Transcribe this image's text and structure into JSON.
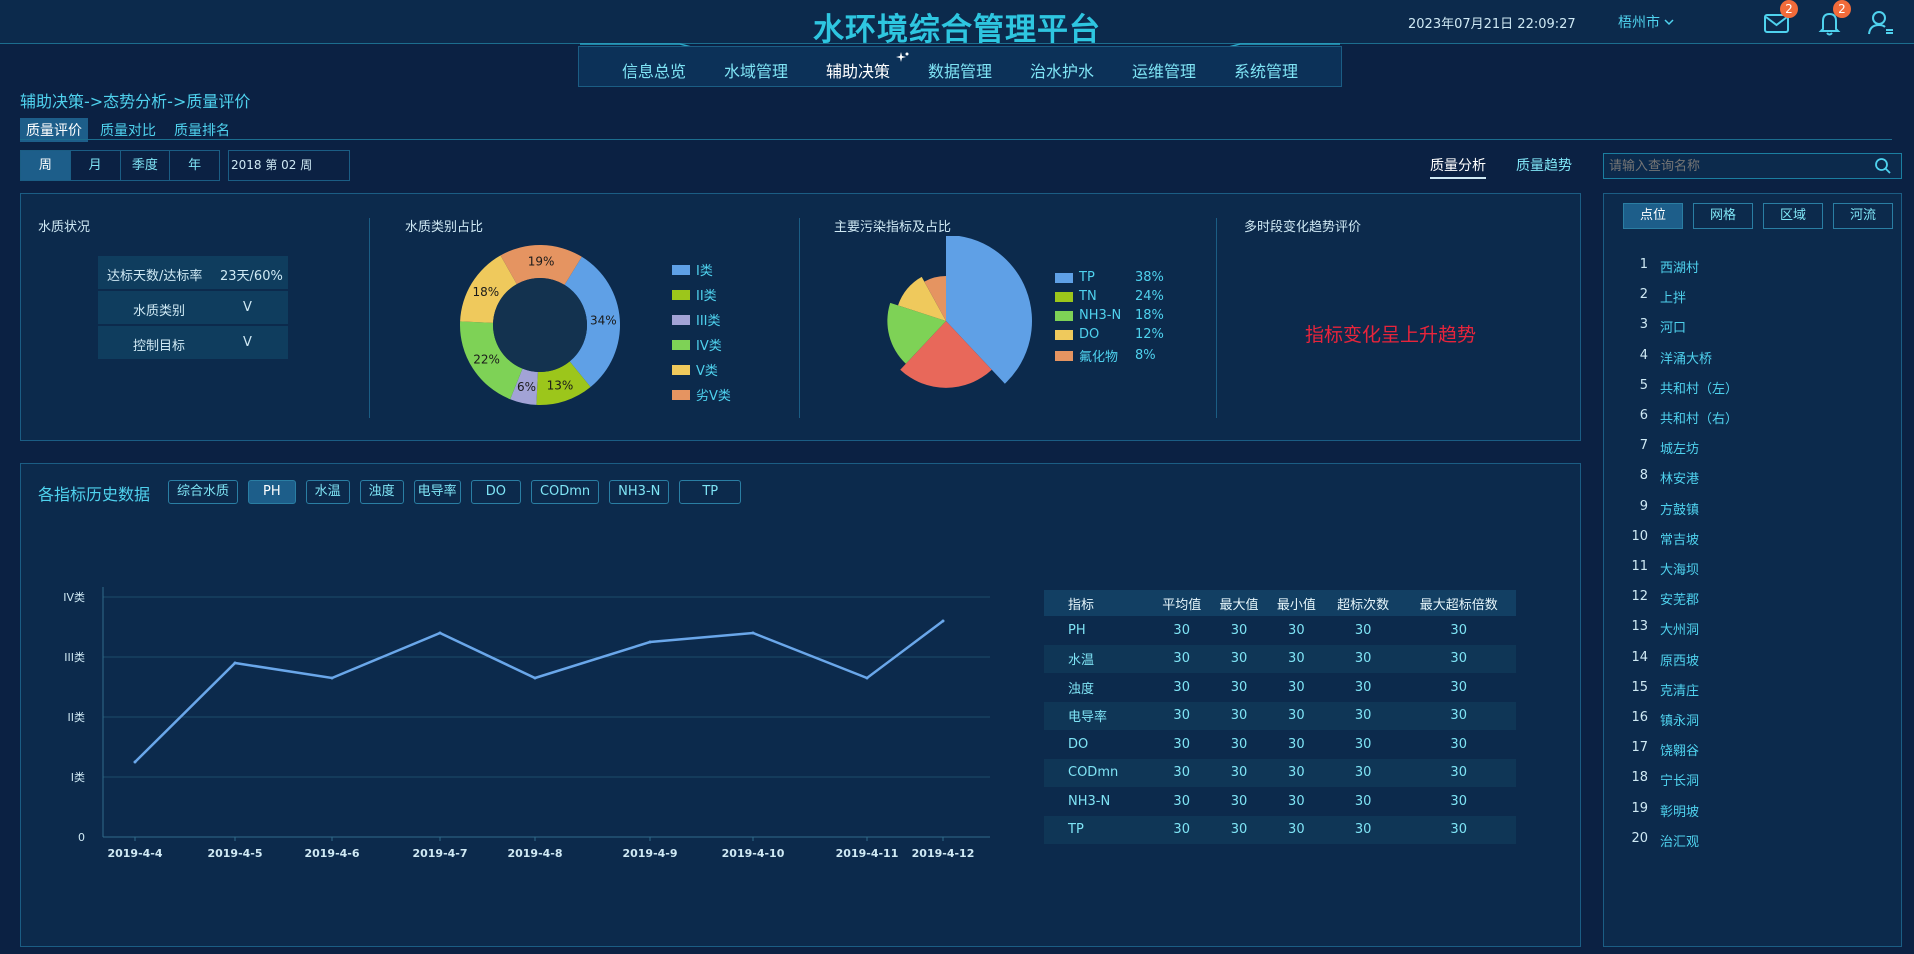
{
  "header": {
    "title": "水环境综合管理平台",
    "datetime": "2023年07月21日 22:09:27",
    "city": "梧州市",
    "mail_count": "2",
    "notify_count": "2"
  },
  "nav": [
    "信息总览",
    "水域管理",
    "辅助决策",
    "数据管理",
    "治水护水",
    "运维管理",
    "系统管理"
  ],
  "breadcrumb": "辅助决策->态势分析->质量评价",
  "subtabs": [
    "质量评价",
    "质量对比",
    "质量排名"
  ],
  "period": {
    "buttons": [
      "周",
      "月",
      "季度",
      "年"
    ],
    "week_value": "2018 第 02 周"
  },
  "analysis_tabs": [
    "质量分析",
    "质量趋势"
  ],
  "search": {
    "placeholder": "请输入查询名称"
  },
  "water_status": {
    "title": "水质状况",
    "rows": [
      {
        "label": "达标天数/达标率",
        "value": "23天/60%"
      },
      {
        "label": "水质类别",
        "value": "V"
      },
      {
        "label": "控制目标",
        "value": "V"
      }
    ]
  },
  "water_class": {
    "title": "水质类别占比",
    "slices": [
      {
        "label": "I类",
        "pct": 34,
        "color": "#5fa0e6"
      },
      {
        "label": "II类",
        "pct": 13,
        "color": "#9cc61b"
      },
      {
        "label": "III类",
        "pct": 6,
        "color": "#a2a3d6"
      },
      {
        "label": "IV类",
        "pct": 22,
        "color": "#7ed256"
      },
      {
        "label": "V类",
        "pct": 18,
        "color": "#efc95c"
      },
      {
        "label": "劣V类",
        "pct": 19,
        "color": "#e59461"
      }
    ],
    "pct_labels": [
      "34%",
      "13%",
      "6%",
      "22%",
      "18%",
      "19%"
    ]
  },
  "pollutants": {
    "title": "主要污染指标及占比",
    "items": [
      {
        "name": "TP",
        "pct": "38%",
        "value": 38,
        "color": "#5fa0e6"
      },
      {
        "name": "TN",
        "pct": "24%",
        "value": 24,
        "color": "#9cc61b"
      },
      {
        "name": "NH3-N",
        "pct": "18%",
        "value": 18,
        "color": "#7ed256"
      },
      {
        "name": "DO",
        "pct": "12%",
        "value": 12,
        "color": "#efc95c"
      },
      {
        "name": "氟化物",
        "pct": "8%",
        "value": 8,
        "color": "#e59461"
      }
    ]
  },
  "multi_period": {
    "title": "多时段变化趋势评价",
    "text": "指标变化呈上升趋势"
  },
  "history": {
    "title": "各指标历史数据",
    "buttons": [
      "综合水质",
      "PH",
      "水温",
      "浊度",
      "电导率",
      "DO",
      "CODmn",
      "NH3-N",
      "TP"
    ],
    "active": "PH"
  },
  "chart_data": {
    "type": "line",
    "x": [
      "2019-4-4",
      "2019-4-5",
      "2019-4-6",
      "2019-4-7",
      "2019-4-8",
      "2019-4-9",
      "2019-4-10",
      "2019-4-11",
      "2019-4-12"
    ],
    "y": [
      1.25,
      2.9,
      2.65,
      3.4,
      2.65,
      3.25,
      3.4,
      2.65,
      3.6
    ],
    "y_ticks": [
      "0",
      "I类",
      "II类",
      "III类",
      "IV类"
    ],
    "ylim": [
      0,
      4
    ]
  },
  "table": {
    "headers": [
      "指标",
      "平均值",
      "最大值",
      "最小值",
      "超标次数",
      "最大超标倍数"
    ],
    "rows": [
      [
        "PH",
        "30",
        "30",
        "30",
        "30",
        "30"
      ],
      [
        "水温",
        "30",
        "30",
        "30",
        "30",
        "30"
      ],
      [
        "浊度",
        "30",
        "30",
        "30",
        "30",
        "30"
      ],
      [
        "电导率",
        "30",
        "30",
        "30",
        "30",
        "30"
      ],
      [
        "DO",
        "30",
        "30",
        "30",
        "30",
        "30"
      ],
      [
        "CODmn",
        "30",
        "30",
        "30",
        "30",
        "30"
      ],
      [
        "NH3-N",
        "30",
        "30",
        "30",
        "30",
        "30"
      ],
      [
        "TP",
        "30",
        "30",
        "30",
        "30",
        "30"
      ]
    ]
  },
  "right_panel": {
    "tabs": [
      "点位",
      "网格",
      "区域",
      "河流"
    ],
    "items": [
      "西湖村",
      "上拌",
      "河口",
      "洋涌大桥",
      "共和村（左）",
      "共和村（右）",
      "城左坊",
      "林安港",
      "方鼓镇",
      "常吉坡",
      "大海坝",
      "安芜郡",
      "大州洞",
      "原西坡",
      "克清庄",
      "镇永洞",
      "饶翱谷",
      "宁长洞",
      "彰明坡",
      "治汇观"
    ]
  }
}
